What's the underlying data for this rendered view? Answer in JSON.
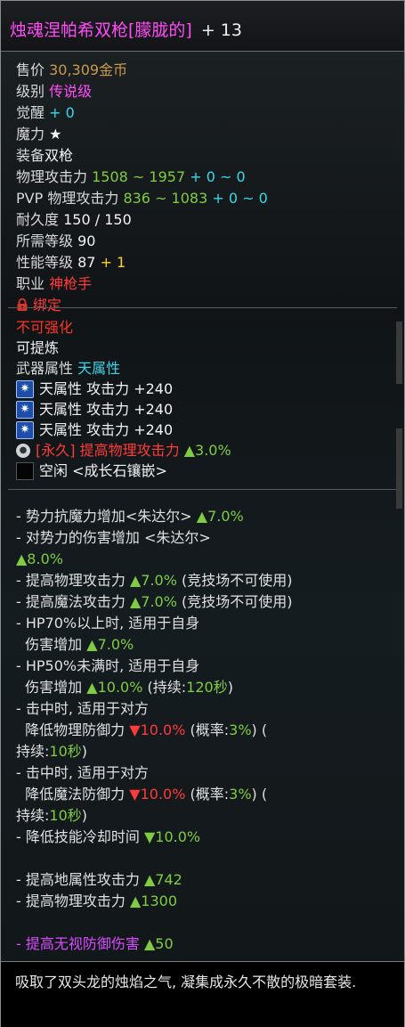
{
  "title": {
    "name": "烛魂涅帕希双枪[朦胧的]",
    "enhance": "+ 13"
  },
  "stats": {
    "price_label": "售价",
    "price_value": "30,309金币",
    "grade_label": "级别",
    "grade_value": "传说级",
    "awaken_label": "觉醒",
    "awaken_value": "+ 0",
    "magic_label": "魔力",
    "magic_value": "★",
    "equip_label": "装备",
    "equip_value": "双枪",
    "phys_label": "物理攻击力",
    "phys_range": "1508 ~ 1957",
    "phys_bonus": "+ 0 ~ 0",
    "pvp_label": "PVP 物理攻击力",
    "pvp_range": "836 ~ 1083",
    "pvp_bonus": "+ 0 ~ 0",
    "durability_label": "耐久度",
    "durability_value": "150 / 150",
    "req_level_label": "所需等级",
    "req_level_value": "90",
    "perf_label": "性能等级",
    "perf_value": "87",
    "perf_bonus": "+ 1",
    "job_label": "职业",
    "job_value": "神枪手",
    "bind_label": "绑定"
  },
  "props": {
    "no_enhance": "不可强化",
    "refinable": "可提炼",
    "element_label": "武器属性",
    "element_value": "天属性",
    "elem_lines": [
      {
        "element": "天属性",
        "text": "攻击力 +240"
      },
      {
        "element": "天属性",
        "text": "攻击力 +240"
      },
      {
        "element": "天属性",
        "text": "攻击力 +240"
      }
    ],
    "perm_tag": "[永久]",
    "perm_text": "提高物理攻击力",
    "perm_value": "▲3.0%",
    "slot_text": "空闲 <成长石镶嵌>"
  },
  "effects": {
    "l1a": "- 势力抗魔力增加<朱达尔>",
    "l1b": "▲7.0%",
    "l2a": "- 对势力的伤害增加  <朱达尔>",
    "l3": "▲8.0%",
    "l4a": "- 提高物理攻击力",
    "l4b": "▲7.0%",
    "l4c": "(竞技场不可使用)",
    "l5a": "- 提高魔法攻击力",
    "l5b": "▲7.0%",
    "l5c": "(竞技场不可使用)",
    "l6": "- HP70%以上时, 适用于自身",
    "l7a": "伤害增加",
    "l7b": "▲7.0%",
    "l8": "- HP50%未满时, 适用于自身",
    "l9a": "伤害增加",
    "l9b": "▲10.0%",
    "l9c": "(持续:",
    "l9d": "120秒",
    "l9e": ")",
    "l10": "- 击中时, 适用于对方",
    "l11a": "降低物理防御力",
    "l11b": "▼10.0%",
    "l11c": "(概率:",
    "l11d": "3%",
    "l11e": ") (",
    "l12a": "持续:",
    "l12b": "10秒",
    "l12c": ")",
    "l13": "- 击中时, 适用于对方",
    "l14a": "降低魔法防御力",
    "l14b": "▼10.0%",
    "l14c": "(概率:",
    "l14d": "3%",
    "l14e": ") (",
    "l15a": "持续:",
    "l15b": "10秒",
    "l15c": ")",
    "l16a": "- 降低技能冷却时间",
    "l16b": "▼10.0%",
    "l17a": "- 提高地属性攻击力",
    "l17b": "▲742",
    "l18a": "- 提高物理攻击力",
    "l18b": "▲1300",
    "l19a": "- 提高无视防御伤害",
    "l19b": "▲50"
  },
  "footer": {
    "text": "吸取了双头龙的烛焰之气, 凝集成永久不散的极暗套装."
  },
  "colors": {
    "legend_pink": "#ff4df6",
    "green": "#7fcc42",
    "cyan": "#36d8e8",
    "red": "#ff3a3a",
    "purple": "#d84cff"
  }
}
